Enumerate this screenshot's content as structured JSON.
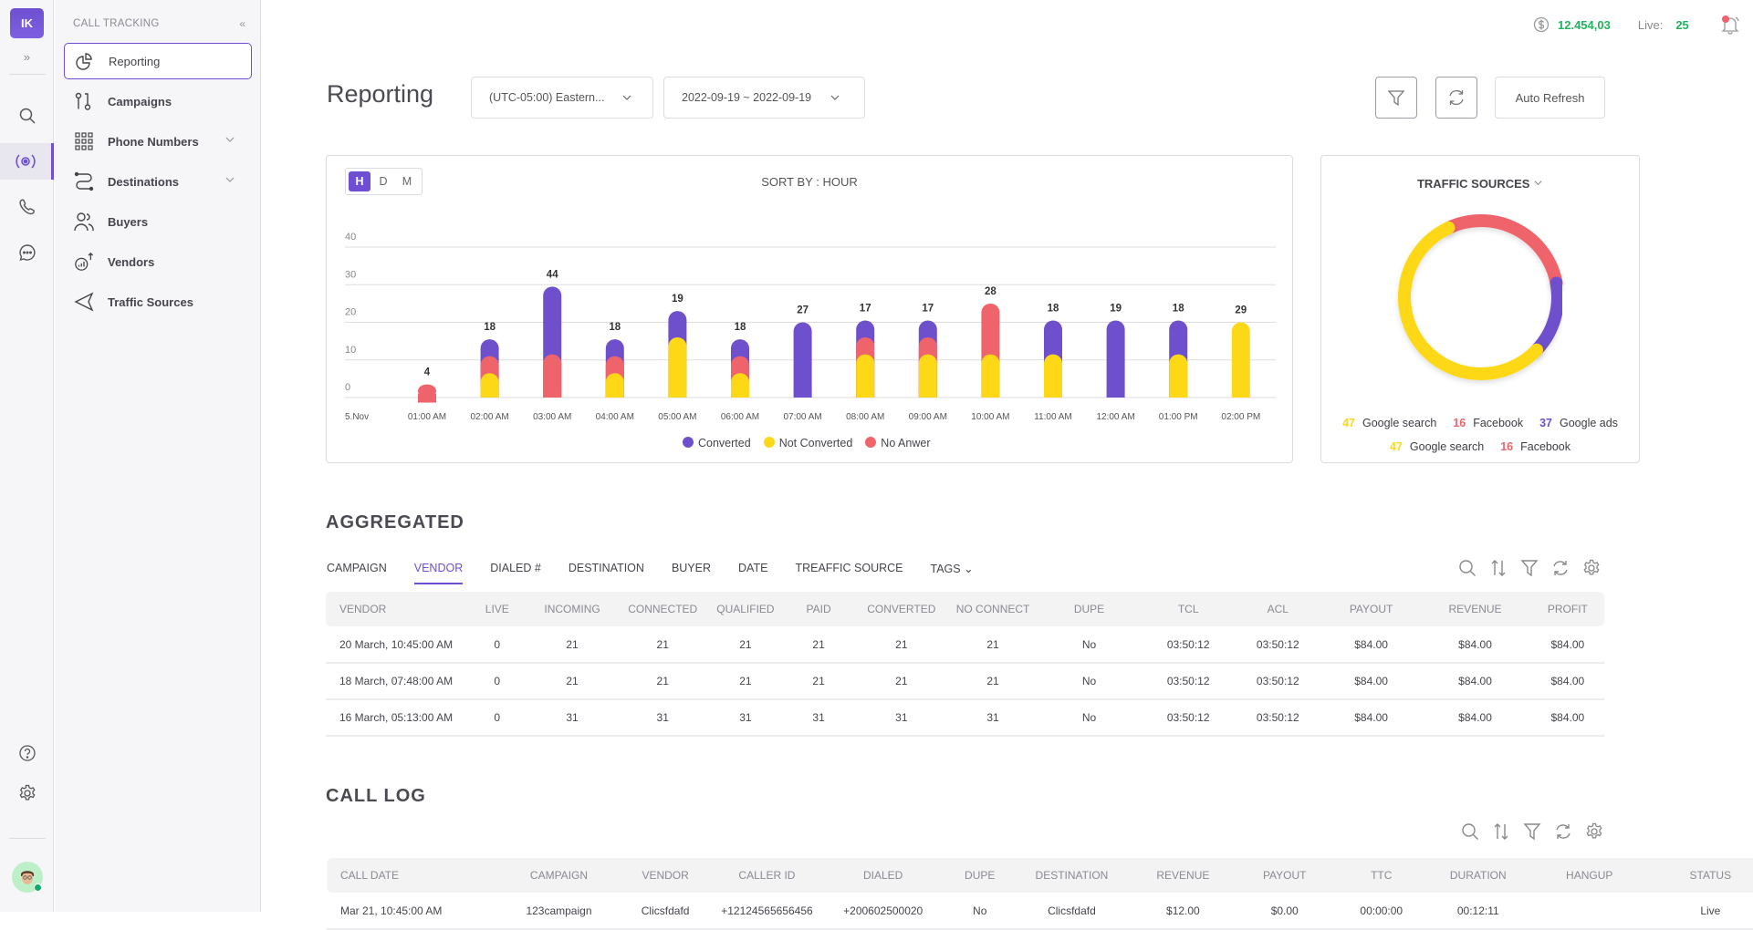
{
  "rail": {
    "logo": "IK",
    "expand_icon": "»",
    "items": [
      {
        "name": "search",
        "active": false
      },
      {
        "name": "call-tracking",
        "active": true
      },
      {
        "name": "phone",
        "active": false
      },
      {
        "name": "chat",
        "active": false
      }
    ],
    "bottom": [
      {
        "name": "help"
      },
      {
        "name": "settings"
      }
    ]
  },
  "sidebar": {
    "header": "CALL TRACKING",
    "collapse_icon": "«",
    "items": [
      {
        "label": "Reporting",
        "icon": "pie-chart-icon",
        "active": true,
        "expandable": false
      },
      {
        "label": "Campaigns",
        "icon": "route-icon",
        "active": false,
        "expandable": false
      },
      {
        "label": "Phone Numbers",
        "icon": "grid-icon",
        "active": false,
        "expandable": true
      },
      {
        "label": "Destinations",
        "icon": "destination-path-icon",
        "active": false,
        "expandable": true
      },
      {
        "label": "Buyers",
        "icon": "users-icon",
        "active": false,
        "expandable": false
      },
      {
        "label": "Vendors",
        "icon": "vendor-chart-icon",
        "active": false,
        "expandable": false
      },
      {
        "label": "Traffic Sources",
        "icon": "send-icon",
        "active": false,
        "expandable": false
      }
    ]
  },
  "topbar": {
    "balance": "12.454,03",
    "live_label": "Live:",
    "live_count": "25",
    "accent_green": "#22b35e"
  },
  "header": {
    "title": "Reporting",
    "timezone": "(UTC-05:00) Eastern...",
    "date_range": "2022-09-19 ~ 2022-09-19",
    "auto_refresh": "Auto Refresh"
  },
  "colors": {
    "converted": "#6e4fcc",
    "not_converted": "#fdd817",
    "no_answer": "#ef636b",
    "accent": "#6e4fd3"
  },
  "chart_controls": {
    "granularity": [
      "H",
      "D",
      "M"
    ],
    "selected": "H",
    "sort_label": "SORT BY : HOUR"
  },
  "chart_data": [
    {
      "type": "bar",
      "stacked": true,
      "title": "SORT BY : HOUR",
      "xlabel": "",
      "ylabel": "",
      "ylim": [
        0,
        40
      ],
      "yticks": [
        0,
        10,
        20,
        30,
        40
      ],
      "grid": true,
      "legend_position": "bottom",
      "categories": [
        "5.Nov",
        "01:00 AM",
        "02:00 AM",
        "03:00 AM",
        "04:00 AM",
        "05:00 AM",
        "06:00 AM",
        "07:00 AM",
        "08:00 AM",
        "09:00 AM",
        "10:00 AM",
        "11:00 AM",
        "12:00 AM",
        "01:00 PM",
        "02:00 PM"
      ],
      "total_labels": [
        null,
        4,
        18,
        44,
        18,
        19,
        18,
        27,
        17,
        17,
        28,
        18,
        19,
        18,
        29
      ],
      "series": [
        {
          "name": "Not Converted",
          "key": "not_converted",
          "values": [
            0,
            0,
            6.5,
            0,
            6.5,
            16,
            6.5,
            0,
            11.5,
            11.5,
            11.5,
            11.5,
            0,
            11.5,
            20
          ]
        },
        {
          "name": "No Anwer",
          "key": "no_answer",
          "values": [
            0,
            3.5,
            4.5,
            11.5,
            4.5,
            0,
            4.5,
            0,
            4.5,
            4.5,
            13.5,
            0,
            0,
            0,
            0
          ]
        },
        {
          "name": "Converted",
          "key": "converted",
          "values": [
            0,
            0,
            4.5,
            18,
            4.5,
            7,
            4.5,
            20,
            4.5,
            4.5,
            0,
            9,
            20.5,
            9,
            0
          ]
        }
      ]
    },
    {
      "type": "pie",
      "donut": true,
      "title": "TRAFFIC SOURCES",
      "slices": [
        {
          "label": "Facebook",
          "key": "no_answer",
          "share": 0.29
        },
        {
          "label": "Google ads",
          "key": "converted",
          "share": 0.15
        },
        {
          "label": "Google search",
          "key": "not_converted",
          "share": 0.56
        }
      ],
      "legend": [
        {
          "value": "47",
          "label": "Google search",
          "key": "not_converted"
        },
        {
          "value": "16",
          "label": "Facebook",
          "key": "no_answer"
        },
        {
          "value": "37",
          "label": "Google ads",
          "key": "converted"
        },
        {
          "value": "47",
          "label": "Google search",
          "key": "not_converted"
        },
        {
          "value": "16",
          "label": "Facebook",
          "key": "no_answer"
        }
      ]
    }
  ],
  "aggregated": {
    "title": "AGGREGATED",
    "tabs": [
      "CAMPAIGN",
      "VENDOR",
      "DIALED #",
      "DESTINATION",
      "BUYER",
      "DATE",
      "TREAFFIC SOURCE",
      "TAGS"
    ],
    "active_tab": "VENDOR",
    "columns": [
      "VENDOR",
      "LIVE",
      "INCOMING",
      "CONNECTED",
      "QUALIFIED",
      "PAID",
      "CONVERTED",
      "NO CONNECT",
      "DUPE",
      "TCL",
      "ACL",
      "PAYOUT",
      "REVENUE",
      "PROFIT"
    ],
    "rows": [
      [
        "20 March, 10:45:00 AM",
        "0",
        "21",
        "21",
        "21",
        "21",
        "21",
        "21",
        "No",
        "03:50:12",
        "03:50:12",
        "$84.00",
        "$84.00",
        "$84.00"
      ],
      [
        "18 March, 07:48:00 AM",
        "0",
        "21",
        "21",
        "21",
        "21",
        "21",
        "21",
        "No",
        "03:50:12",
        "03:50:12",
        "$84.00",
        "$84.00",
        "$84.00"
      ],
      [
        "16 March, 05:13:00 AM",
        "0",
        "31",
        "31",
        "31",
        "31",
        "31",
        "31",
        "No",
        "03:50:12",
        "03:50:12",
        "$84.00",
        "$84.00",
        "$84.00"
      ]
    ]
  },
  "call_log": {
    "title": "CALL LOG",
    "columns": [
      "CALL DATE",
      "CAMPAIGN",
      "VENDOR",
      "CALLER ID",
      "DIALED",
      "DUPE",
      "DESTINATION",
      "REVENUE",
      "PAYOUT",
      "TTC",
      "DURATION",
      "HANGUP",
      "STATUS"
    ],
    "rows": [
      [
        "Mar 21, 10:45:00 AM",
        "123campaign",
        "Clicsfdafd",
        "+12124565656456",
        "+200602500020",
        "No",
        "Clicsfdafd",
        "$12.00",
        "$0.00",
        "00:00:00",
        "00:12:11",
        "",
        "Live"
      ]
    ]
  }
}
